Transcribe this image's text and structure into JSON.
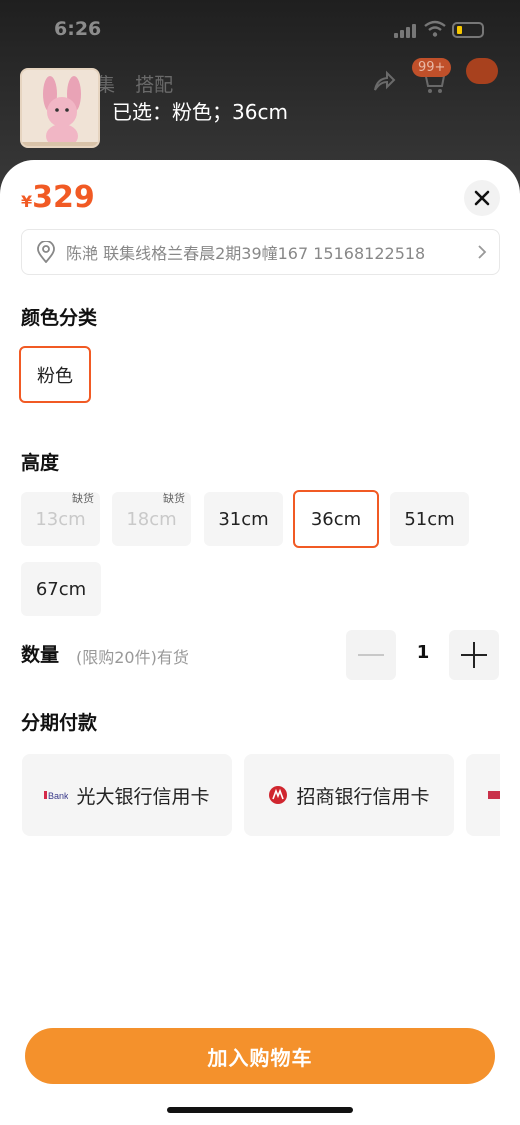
{
  "status_bar": {
    "time": "6:26"
  },
  "background": {
    "tabs": [
      "集",
      "搭配"
    ],
    "cart_badge": "99+"
  },
  "header": {
    "selected_label": "已选：粉色；36cm"
  },
  "price": {
    "currency": "¥",
    "amount": "329"
  },
  "address": {
    "text": "陈滟 联集线格兰春晨2期39幢167 15168122518"
  },
  "color_section": {
    "title": "颜色分类",
    "options": [
      {
        "label": "粉色",
        "selected": true
      }
    ]
  },
  "height_section": {
    "title": "高度",
    "options": [
      {
        "label": "13cm",
        "tag": "缺货",
        "disabled": true
      },
      {
        "label": "18cm",
        "tag": "缺货",
        "disabled": true
      },
      {
        "label": "31cm"
      },
      {
        "label": "36cm",
        "selected": true
      },
      {
        "label": "51cm"
      },
      {
        "label": "67cm"
      }
    ]
  },
  "quantity": {
    "label": "数量",
    "hint": "(限购20件)有货",
    "value": "1"
  },
  "installment": {
    "title": "分期付款",
    "cards": [
      {
        "label": "光大银行信用卡",
        "logo_text": "Bank"
      },
      {
        "label": "招商银行信用卡"
      }
    ]
  },
  "cta": {
    "label": "加入购物车"
  },
  "colors": {
    "accent": "#f15a24",
    "cta": "#f4912c"
  }
}
